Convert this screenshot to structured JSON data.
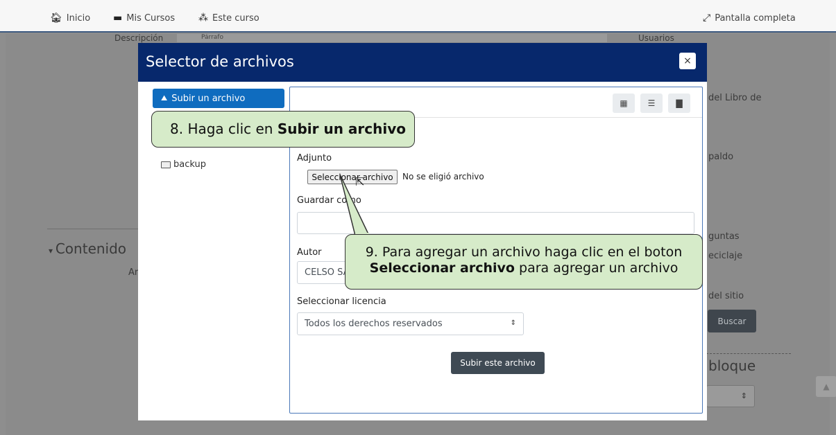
{
  "navbar": {
    "inicio": "Inicio",
    "mis_cursos": "Mis Cursos",
    "este_curso": "Este curso",
    "pantalla_completa": "Pantalla completa"
  },
  "background": {
    "descripcion": "Descripción",
    "parrafo": "Párrafo",
    "usuarios": "Usuarios",
    "libro_de": "del Libro de",
    "respaldo": "paldo",
    "preguntas": "guntas",
    "reciclaje": "eciclaje",
    "del_sitio": "del sitio",
    "buscar": "Buscar",
    "bloque": "bloque",
    "contenido": "Contenido",
    "ar": "Ar"
  },
  "modal": {
    "title": "Selector de archivos",
    "close": "×",
    "repo_upload": "Subir un archivo",
    "repo_backup": "backup",
    "adjunto_label": "Adjunto",
    "file_button": "Seleccionar archivo",
    "file_status": "No se eligió archivo",
    "guardar_label": "Guardar como",
    "guardar_value": "",
    "autor_label": "Autor",
    "autor_value": "CELSO SA",
    "licencia_label": "Seleccionar licencia",
    "licencia_value": "Todos los derechos reservados",
    "submit": "Subir este archivo"
  },
  "callouts": {
    "step8_prefix": "8. Haga clic en ",
    "step8_bold": "Subir un archivo",
    "step9_line1": "9. Para agregar un archivo haga clic en el boton",
    "step9_bold": "Seleccionar archivo",
    "step9_suffix": " para agregar un archivo"
  },
  "colors": {
    "modal_header": "#07286c",
    "repo_active": "#0f6cbf",
    "callout_bg": "#d6ebc9",
    "submit_btn": "#3f4a54"
  }
}
